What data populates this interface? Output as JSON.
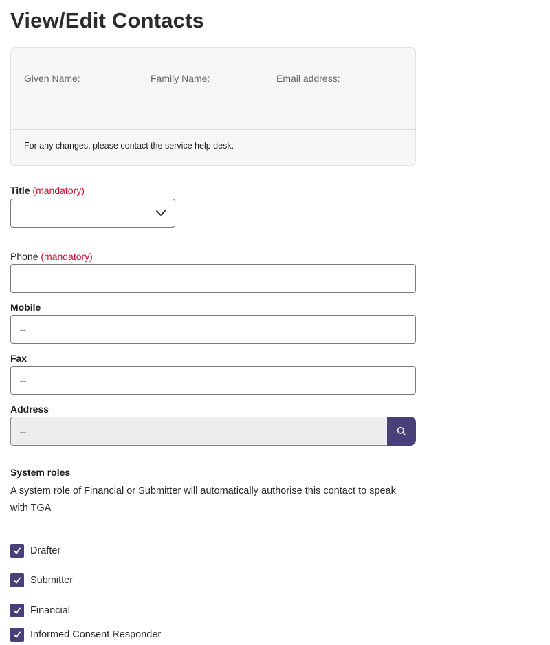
{
  "page": {
    "title": "View/Edit Contacts"
  },
  "info_card": {
    "given_name_label": "Given Name:",
    "family_name_label": "Family Name:",
    "email_label": "Email address:",
    "note": "For any changes, please contact the service help desk."
  },
  "form": {
    "title": {
      "label": "Title",
      "mandatory": "(mandatory)",
      "value": ""
    },
    "phone": {
      "label": "Phone",
      "mandatory": "(mandatory)",
      "value": ""
    },
    "mobile": {
      "label": "Mobile",
      "placeholder": "--"
    },
    "fax": {
      "label": "Fax",
      "placeholder": "--"
    },
    "address": {
      "label": "Address",
      "placeholder": "--"
    }
  },
  "roles": {
    "heading": "System roles",
    "description": "A system role of Financial or Submitter will automatically authorise this contact to speak with TGA",
    "items": [
      {
        "label": "Drafter",
        "checked": true
      },
      {
        "label": "Submitter",
        "checked": true
      },
      {
        "label": "Financial",
        "checked": true
      },
      {
        "label": "Informed Consent Responder",
        "checked": true
      }
    ]
  },
  "icons": {
    "title_dropdown": "chevron-down-icon",
    "address_search": "search-icon",
    "checkbox": "checkmark-icon"
  },
  "colors": {
    "accent": "#4a3f78",
    "mandatory": "#c8102e",
    "card_bg": "#f6f6f6",
    "disabled_input_bg": "#ededed"
  }
}
